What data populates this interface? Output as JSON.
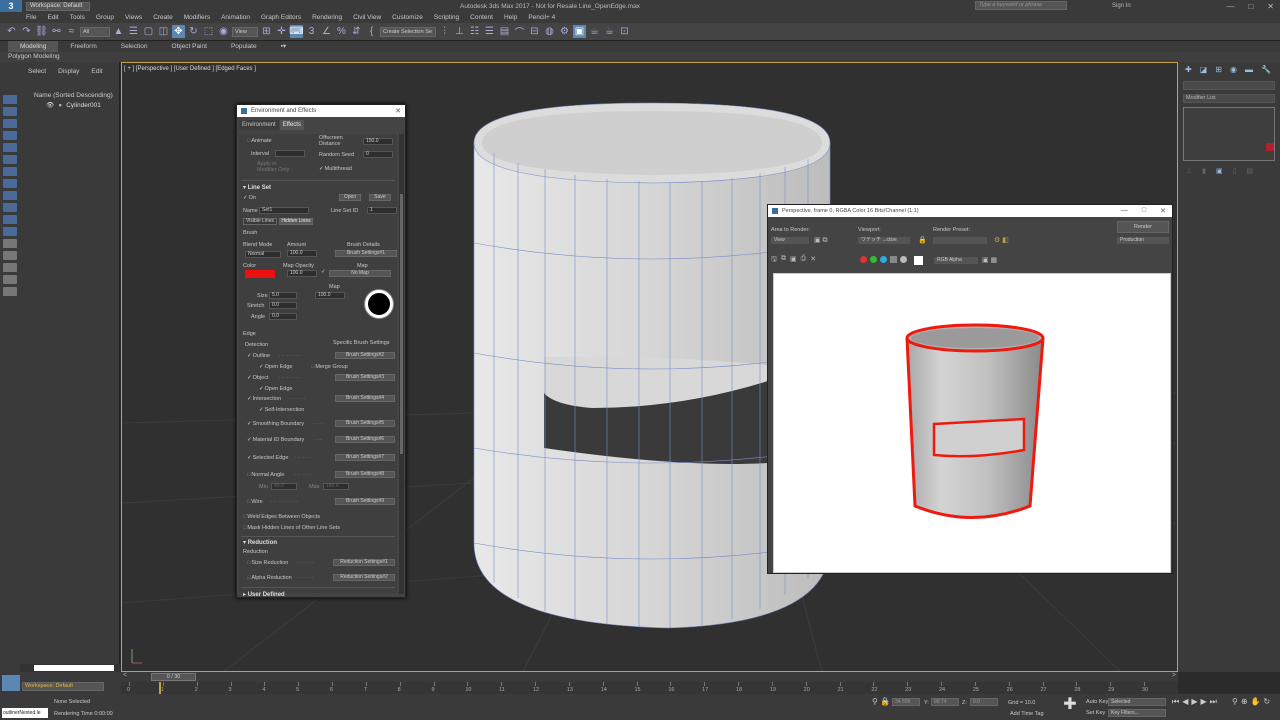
{
  "titlebar": {
    "workspace": "Workspace: Default",
    "title": "Autodesk 3ds Max 2017 - Not for Resale   Line_OpenEdge.max",
    "search_placeholder": "Type a keyword or phrase",
    "signin": "Sign In"
  },
  "menu": [
    "File",
    "Edit",
    "Tools",
    "Group",
    "Views",
    "Create",
    "Modifiers",
    "Animation",
    "Graph Editors",
    "Rendering",
    "Civil View",
    "Customize",
    "Scripting",
    "Content",
    "Help",
    "Pencil+ 4"
  ],
  "toolbar": {
    "filter_dd": "All",
    "view_dd": "View",
    "selection_set": "Create Selection Se"
  },
  "ribbon": {
    "tabs": [
      "Modeling",
      "Freeform",
      "Selection",
      "Object Paint",
      "Populate"
    ],
    "active": "Modeling",
    "sub": "Polygon Modeling"
  },
  "scene_explorer": {
    "menu": [
      "Select",
      "Display",
      "Edit"
    ],
    "column_header": "Name (Sorted Descending)",
    "items": [
      "Cylinder001"
    ]
  },
  "viewport": {
    "label": "[ + ] [Perspective ] [User Defined ] [Edged Faces ]"
  },
  "env_dialog": {
    "title": "Environment and Effects",
    "tabs": [
      "Environment",
      "Effects"
    ],
    "active_tab": "Effects",
    "top": {
      "animate": "Animate",
      "interval_lbl": "Interval",
      "apply_modifier": "Apply in Modifier Only",
      "offscreen_lbl": "Offscreen Distance",
      "offscreen_val": "150.0",
      "random_seed_lbl": "Random Seed",
      "random_seed_val": "0",
      "multithread": "Multithread"
    },
    "lineset": {
      "title": "Line Set",
      "on": "On",
      "open": "Open",
      "save": "Save",
      "name_lbl": "Name",
      "name_val": "Set1",
      "id_lbl": "Line Set ID",
      "id_val": "1",
      "subtabs": [
        "Visible Lines",
        "Hidden Lines"
      ]
    },
    "brush": {
      "title": "Brush",
      "blend_lbl": "Blend Mode",
      "blend_val": "Normal",
      "amount_lbl": "Amount",
      "amount_val": "100.0",
      "details_lbl": "Brush Details",
      "settings1": "Brush Settings#1",
      "color_lbl": "Color",
      "map_opacity_lbl": "Map Opacity",
      "map_opacity_val": "100.0",
      "map_lbl": "Map",
      "no_map": "No Map",
      "map2_lbl": "Map",
      "size_lbl": "Size",
      "size_val": "5.0",
      "size_map_val": "100.0",
      "stretch_lbl": "Stretch",
      "stretch_val": "0.0",
      "angle_lbl": "Angle",
      "angle_val": "0.0"
    },
    "edge": {
      "title": "Edge",
      "detection": "Detection",
      "specific": "Specific Brush Settings",
      "outline": "Outline",
      "open_edge": "Open Edge",
      "merge_group": "Merge Group",
      "object": "Object",
      "open_edge2": "Open Edge",
      "intersection": "Intersection",
      "self_intersection": "Self-Intersection",
      "smoothing": "Smoothing Boundary",
      "material_id": "Material ID Boundary",
      "selected_edge": "Selected Edge",
      "normal_angle": "Normal Angle",
      "min_lbl": "Min",
      "min_val": "45.0",
      "max_lbl": "Max",
      "max_val": "180.0",
      "wire": "Wire",
      "bs2": "Brush Settings#2",
      "bs3": "Brush Settings#3",
      "bs4": "Brush Settings#4",
      "bs5": "Brush Settings#5",
      "bs6": "Brush Settings#6",
      "bs7": "Brush Settings#7",
      "bs8": "Brush Settings#8",
      "bs9": "Brush Settings#9",
      "weld": "Weld Edges Between Objects",
      "mask": "Mask Hidden Lines of Other Line Sets"
    },
    "reduction": {
      "title": "Reduction",
      "sub": "Reduction",
      "size": "Size Reduction",
      "size_btn": "Reduction Settings#1",
      "alpha": "Alpha Reduction",
      "alpha_btn": "Reduction Settings#2"
    },
    "user_defined": "User Defined"
  },
  "render_window": {
    "title": "Perspective, frame 0, RGBA Color 16 Bits/Channel (1:1)",
    "area_lbl": "Area to Render:",
    "area_val": "View",
    "viewport_lbl": "Viewport:",
    "viewport_val": "ワテッチ ...ctive",
    "preset_lbl": "Render Preset:",
    "render_btn": "Render",
    "production": "Production",
    "channel": "RGB Alpha"
  },
  "timeline": {
    "slider": "0 / 30",
    "ticks": [
      "0",
      "1",
      "2",
      "3",
      "4",
      "5",
      "6",
      "7",
      "8",
      "9",
      "10",
      "11",
      "12",
      "13",
      "14",
      "15",
      "16",
      "17",
      "18",
      "19",
      "20",
      "21",
      "22",
      "23",
      "24",
      "25",
      "26",
      "27",
      "28",
      "29",
      "30"
    ]
  },
  "status": {
    "workspace": "Workspace: Default",
    "none_selected": "None Selected",
    "rendering_time": "Rendering Time  0:00:00",
    "maxscript": "outlinerNested.le",
    "x_lbl": "X:",
    "x_val": "34.509",
    "y_lbl": "Y:",
    "y_val": "90.74",
    "z_lbl": "Z:",
    "z_val": "0.0",
    "grid": "Grid = 10.0",
    "add_time_tag": "Add Time Tag",
    "auto_key": "Auto Key",
    "set_key": "Set Key",
    "selected": "Selected",
    "key_filters": "Key Filters..."
  },
  "modifier_list": "Modifier List",
  "colors": {
    "accent": "#5b87b5",
    "line_red": "#ee1a10",
    "viewport_border": "#c8a23c"
  }
}
